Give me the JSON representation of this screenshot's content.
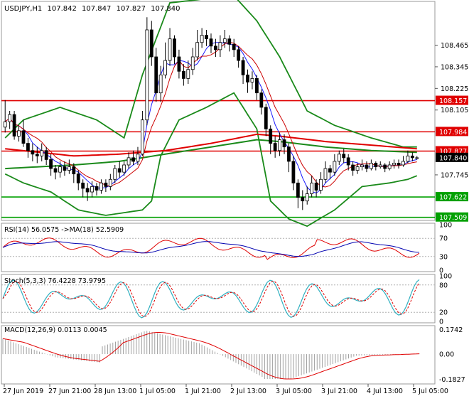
{
  "chart_data": [
    {
      "type": "candlestick",
      "symbol": "USDJPY,H1",
      "ohlc": {
        "open": "107.842",
        "high": "107.847",
        "low": "107.827",
        "close": "107.840"
      },
      "ylim": [
        107.5,
        108.7
      ],
      "y_ticks": [
        "108.465",
        "108.345",
        "108.225",
        "108.105",
        "107.745"
      ],
      "price_levels": [
        {
          "label": "108.157",
          "value": 108.157,
          "color": "#e00000"
        },
        {
          "label": "107.984",
          "value": 107.984,
          "color": "#e00000"
        },
        {
          "label": "107.877",
          "value": 107.877,
          "color": "#e00000"
        },
        {
          "label": "107.840",
          "value": 107.84,
          "color": "#000000"
        },
        {
          "label": "107.622",
          "value": 107.622,
          "color": "#00a000"
        },
        {
          "label": "107.509",
          "value": 107.509,
          "color": "#00a000"
        }
      ],
      "candles": [
        [
          108.01,
          108.04,
          108.16,
          107.98
        ],
        [
          108.04,
          108.08,
          108.1,
          108.0
        ],
        [
          108.08,
          107.96,
          108.1,
          107.94
        ],
        [
          107.96,
          107.99,
          108.02,
          107.93
        ],
        [
          107.99,
          107.92,
          108.05,
          107.9
        ],
        [
          107.92,
          107.88,
          107.95,
          107.84
        ],
        [
          107.88,
          107.86,
          107.92,
          107.82
        ],
        [
          107.86,
          107.85,
          107.9,
          107.81
        ],
        [
          107.85,
          107.88,
          107.92,
          107.82
        ],
        [
          107.88,
          107.83,
          107.9,
          107.8
        ],
        [
          107.83,
          107.78,
          107.86,
          107.74
        ],
        [
          107.78,
          107.76,
          107.8,
          107.72
        ],
        [
          107.76,
          107.79,
          107.82,
          107.73
        ],
        [
          107.79,
          107.77,
          107.82,
          107.74
        ],
        [
          107.77,
          107.79,
          107.83,
          107.75
        ],
        [
          107.79,
          107.75,
          107.81,
          107.7
        ],
        [
          107.75,
          107.7,
          107.77,
          107.66
        ],
        [
          107.7,
          107.67,
          107.72,
          107.62
        ],
        [
          107.67,
          107.65,
          107.7,
          107.6
        ],
        [
          107.65,
          107.68,
          107.71,
          107.62
        ],
        [
          107.68,
          107.66,
          107.7,
          107.63
        ],
        [
          107.66,
          107.7,
          107.72,
          107.64
        ],
        [
          107.7,
          107.68,
          107.72,
          107.65
        ],
        [
          107.68,
          107.72,
          107.75,
          107.66
        ],
        [
          107.72,
          107.78,
          107.8,
          107.7
        ],
        [
          107.78,
          107.76,
          107.82,
          107.73
        ],
        [
          107.76,
          107.8,
          107.82,
          107.74
        ],
        [
          107.8,
          107.84,
          107.87,
          107.78
        ],
        [
          107.84,
          107.82,
          107.88,
          107.8
        ],
        [
          107.82,
          107.86,
          107.9,
          107.8
        ],
        [
          107.86,
          108.05,
          108.1,
          107.85
        ],
        [
          108.05,
          108.55,
          108.62,
          108.02
        ],
        [
          108.55,
          108.4,
          108.6,
          108.35
        ],
        [
          108.4,
          108.2,
          108.45,
          108.15
        ],
        [
          108.2,
          108.3,
          108.35,
          108.15
        ],
        [
          108.3,
          108.38,
          108.48,
          108.28
        ],
        [
          108.38,
          108.5,
          108.56,
          108.35
        ],
        [
          108.5,
          108.4,
          108.52,
          108.36
        ],
        [
          108.4,
          108.32,
          108.44,
          108.28
        ],
        [
          108.32,
          108.28,
          108.36,
          108.24
        ],
        [
          108.28,
          108.33,
          108.38,
          108.25
        ],
        [
          108.33,
          108.4,
          108.45,
          108.3
        ],
        [
          108.4,
          108.48,
          108.55,
          108.38
        ],
        [
          108.48,
          108.52,
          108.56,
          108.45
        ],
        [
          108.52,
          108.5,
          108.55,
          108.46
        ],
        [
          108.5,
          108.46,
          108.53,
          108.42
        ],
        [
          108.46,
          108.44,
          108.5,
          108.4
        ],
        [
          108.44,
          108.48,
          108.52,
          108.4
        ],
        [
          108.48,
          108.5,
          108.55,
          108.45
        ],
        [
          108.5,
          108.47,
          108.52,
          108.43
        ],
        [
          108.47,
          108.44,
          108.5,
          108.4
        ],
        [
          108.44,
          108.38,
          108.46,
          108.34
        ],
        [
          108.38,
          108.3,
          108.4,
          108.25
        ],
        [
          108.3,
          108.26,
          108.33,
          108.2
        ],
        [
          108.26,
          108.28,
          108.32,
          108.22
        ],
        [
          108.28,
          108.2,
          108.3,
          108.16
        ],
        [
          108.2,
          108.12,
          108.22,
          108.08
        ],
        [
          108.12,
          108.0,
          108.14,
          107.96
        ],
        [
          108.0,
          107.92,
          108.02,
          107.86
        ],
        [
          107.92,
          107.88,
          107.96,
          107.84
        ],
        [
          107.88,
          107.94,
          107.98,
          107.85
        ],
        [
          107.94,
          107.9,
          107.97,
          107.86
        ],
        [
          107.9,
          107.82,
          107.92,
          107.76
        ],
        [
          107.82,
          107.7,
          107.85,
          107.66
        ],
        [
          107.7,
          107.62,
          107.72,
          107.56
        ],
        [
          107.62,
          107.6,
          107.66,
          107.55
        ],
        [
          107.6,
          107.64,
          107.68,
          107.58
        ],
        [
          107.64,
          107.7,
          107.74,
          107.62
        ],
        [
          107.7,
          107.66,
          107.72,
          107.62
        ],
        [
          107.66,
          107.72,
          107.76,
          107.64
        ],
        [
          107.72,
          107.78,
          107.82,
          107.7
        ],
        [
          107.78,
          107.76,
          107.8,
          107.72
        ],
        [
          107.76,
          107.82,
          107.86,
          107.74
        ],
        [
          107.82,
          107.86,
          107.88,
          107.8
        ],
        [
          107.86,
          107.84,
          107.89,
          107.81
        ],
        [
          107.84,
          107.8,
          107.86,
          107.77
        ],
        [
          107.8,
          107.77,
          107.82,
          107.74
        ],
        [
          107.77,
          107.79,
          107.81,
          107.75
        ],
        [
          107.79,
          107.8,
          107.83,
          107.77
        ],
        [
          107.8,
          107.78,
          107.82,
          107.76
        ],
        [
          107.78,
          107.81,
          107.83,
          107.77
        ],
        [
          107.81,
          107.79,
          107.82,
          107.77
        ],
        [
          107.79,
          107.8,
          107.82,
          107.78
        ],
        [
          107.8,
          107.78,
          107.81,
          107.76
        ],
        [
          107.78,
          107.8,
          107.82,
          107.77
        ],
        [
          107.8,
          107.81,
          107.83,
          107.78
        ],
        [
          107.81,
          107.8,
          107.83,
          107.78
        ],
        [
          107.8,
          107.82,
          107.85,
          107.79
        ],
        [
          107.82,
          107.85,
          107.88,
          107.81
        ],
        [
          107.85,
          107.84,
          107.87,
          107.82
        ],
        [
          107.84,
          107.84,
          107.85,
          107.83
        ]
      ],
      "bollinger": {
        "upper_ctrl": [
          [
            0,
            107.95
          ],
          [
            4,
            108.05
          ],
          [
            12,
            108.12
          ],
          [
            20,
            108.05
          ],
          [
            26,
            107.95
          ],
          [
            30,
            108.3
          ],
          [
            36,
            108.7
          ],
          [
            50,
            108.74
          ],
          [
            55,
            108.6
          ],
          [
            60,
            108.4
          ],
          [
            66,
            108.1
          ],
          [
            72,
            108.02
          ],
          [
            80,
            107.95
          ],
          [
            87,
            107.9
          ],
          [
            90,
            107.9
          ]
        ],
        "lower_ctrl": [
          [
            0,
            107.75
          ],
          [
            4,
            107.7
          ],
          [
            10,
            107.65
          ],
          [
            16,
            107.55
          ],
          [
            22,
            107.52
          ],
          [
            30,
            107.55
          ],
          [
            32,
            107.6
          ],
          [
            34,
            107.85
          ],
          [
            38,
            108.05
          ],
          [
            44,
            108.12
          ],
          [
            50,
            108.2
          ],
          [
            55,
            108.0
          ],
          [
            58,
            107.6
          ],
          [
            62,
            107.5
          ],
          [
            66,
            107.46
          ],
          [
            72,
            107.55
          ],
          [
            78,
            107.68
          ],
          [
            84,
            107.7
          ],
          [
            88,
            107.72
          ],
          [
            90,
            107.74
          ]
        ]
      },
      "ma_long": {
        "red_ctrl": [
          [
            0,
            107.89
          ],
          [
            15,
            107.85
          ],
          [
            25,
            107.86
          ],
          [
            35,
            107.88
          ],
          [
            45,
            107.92
          ],
          [
            55,
            107.97
          ],
          [
            60,
            107.96
          ],
          [
            70,
            107.93
          ],
          [
            80,
            107.91
          ],
          [
            90,
            107.89
          ]
        ],
        "green_ctrl": [
          [
            0,
            107.78
          ],
          [
            15,
            107.8
          ],
          [
            25,
            107.82
          ],
          [
            35,
            107.86
          ],
          [
            45,
            107.9
          ],
          [
            55,
            107.94
          ],
          [
            60,
            107.93
          ],
          [
            70,
            107.9
          ],
          [
            80,
            107.88
          ],
          [
            90,
            107.87
          ]
        ]
      },
      "x_labels": [
        "27 Jun 2019",
        "27 Jun 21:00",
        "28 Jun 13:00",
        "1 Jul 05:00",
        "1 Jul 21:00",
        "2 Jul 13:00",
        "3 Jul 05:00",
        "3 Jul 21:00",
        "4 Jul 13:00",
        "5 Jul 05:00"
      ]
    },
    {
      "type": "line",
      "title": "RSI(14) 56.0575 ->MA(18) 52.5909",
      "ylim": [
        0,
        100
      ],
      "y_ticks": [
        "100",
        "70",
        "30",
        "0"
      ],
      "levels": [
        70,
        30
      ]
    },
    {
      "type": "line",
      "title": "Stoch(5,3,3) 76.4228 73.9795",
      "ylim": [
        0,
        100
      ],
      "y_ticks": [
        "100",
        "80",
        "20",
        "0"
      ],
      "levels": [
        80,
        20
      ]
    },
    {
      "type": "histogram",
      "title": "MACD(12,26,9) 0.0113 0.0045",
      "ylim": [
        -0.1827,
        0.1742
      ],
      "y_ticks": [
        "0.1742",
        "0.00",
        "-0.1827"
      ]
    }
  ]
}
